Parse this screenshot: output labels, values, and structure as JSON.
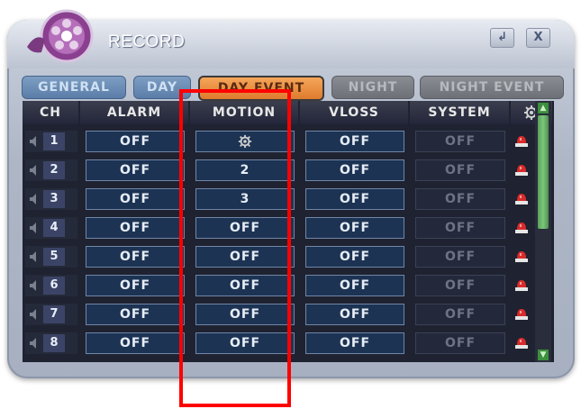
{
  "window": {
    "title": "RECORD"
  },
  "window_buttons": [
    {
      "name": "enter-icon",
      "glyph": "↲"
    },
    {
      "name": "close-icon",
      "glyph": "X"
    }
  ],
  "tabs": [
    {
      "label": "GENERAL",
      "state": "inactive"
    },
    {
      "label": "DAY",
      "state": "inactive"
    },
    {
      "label": "DAY EVENT",
      "state": "active"
    },
    {
      "label": "NIGHT",
      "state": "disabled"
    },
    {
      "label": "NIGHT EVENT",
      "state": "disabled"
    }
  ],
  "table": {
    "columns": [
      "CH",
      "ALARM",
      "MOTION",
      "VLOSS",
      "SYSTEM"
    ],
    "settings_icon": "gear-icon",
    "rows": [
      {
        "ch": "1",
        "alarm": "OFF",
        "motion": "",
        "motion_icon": "gear-icon",
        "vloss": "OFF",
        "system": "OFF"
      },
      {
        "ch": "2",
        "alarm": "OFF",
        "motion": "2",
        "vloss": "OFF",
        "system": "OFF"
      },
      {
        "ch": "3",
        "alarm": "OFF",
        "motion": "3",
        "vloss": "OFF",
        "system": "OFF"
      },
      {
        "ch": "4",
        "alarm": "OFF",
        "motion": "OFF",
        "vloss": "OFF",
        "system": "OFF"
      },
      {
        "ch": "5",
        "alarm": "OFF",
        "motion": "OFF",
        "vloss": "OFF",
        "system": "OFF"
      },
      {
        "ch": "6",
        "alarm": "OFF",
        "motion": "OFF",
        "vloss": "OFF",
        "system": "OFF"
      },
      {
        "ch": "7",
        "alarm": "OFF",
        "motion": "OFF",
        "vloss": "OFF",
        "system": "OFF"
      },
      {
        "ch": "8",
        "alarm": "OFF",
        "motion": "OFF",
        "vloss": "OFF",
        "system": "OFF"
      }
    ]
  },
  "colors": {
    "active_tab": "#e8893a",
    "highlight_box": "#ff0000",
    "scroll_thumb": "#6cb86c",
    "alarm_icon": "#d92b2b"
  }
}
